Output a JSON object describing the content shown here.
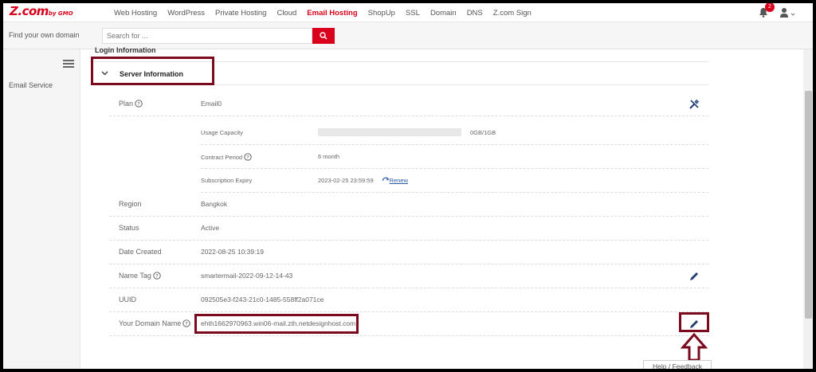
{
  "brand": {
    "name": "Z.com",
    "suffix": "by GMO"
  },
  "nav": {
    "items": [
      {
        "label": "Web Hosting",
        "active": false
      },
      {
        "label": "WordPress",
        "active": false
      },
      {
        "label": "Private Hosting",
        "active": false
      },
      {
        "label": "Cloud",
        "active": false
      },
      {
        "label": "Email Hosting",
        "active": true
      },
      {
        "label": "ShopUp",
        "active": false
      },
      {
        "label": "SSL",
        "active": false
      },
      {
        "label": "Domain",
        "active": false
      },
      {
        "label": "DNS",
        "active": false
      },
      {
        "label": "Z.com Sign",
        "active": false
      }
    ],
    "notification_count": "2"
  },
  "search": {
    "label": "Find your own domain",
    "placeholder": "Search for ...",
    "value": ""
  },
  "sidebar": {
    "items": [
      {
        "label": "Email Service"
      }
    ]
  },
  "section": {
    "collapsed_title": "Login Information",
    "title": "Server Information"
  },
  "plan": {
    "label": "Plan",
    "value": "Email0",
    "usage_label": "Usage Capacity",
    "usage_text": "0GB/1GB",
    "usage_fraction": 0.0,
    "contract_label": "Contract Period",
    "contract_value": "6 month",
    "expiry_label": "Subscription Expiry",
    "expiry_value": "2023-02-25 23:59:59",
    "renew_label": "Renew"
  },
  "details": {
    "region_label": "Region",
    "region_value": "Bangkok",
    "status_label": "Status",
    "status_value": "Active",
    "created_label": "Date Created",
    "created_value": "2022-08-25 10:39:19",
    "nametag_label": "Name Tag",
    "nametag_value": "smartermail-2022-09-12-14-43",
    "uuid_label": "UUID",
    "uuid_value": "092505e3-f243-21c0-1485-558ff2a071ce",
    "domain_label": "Your Domain Name",
    "domain_value": "ehth1662970963.win06-mail.zth.netdesignhost.com"
  },
  "help_feedback": "Help / Feedback",
  "colors": {
    "brand": "#d9001b",
    "highlight": "#7b0a1e",
    "link": "#2a5aa8"
  }
}
